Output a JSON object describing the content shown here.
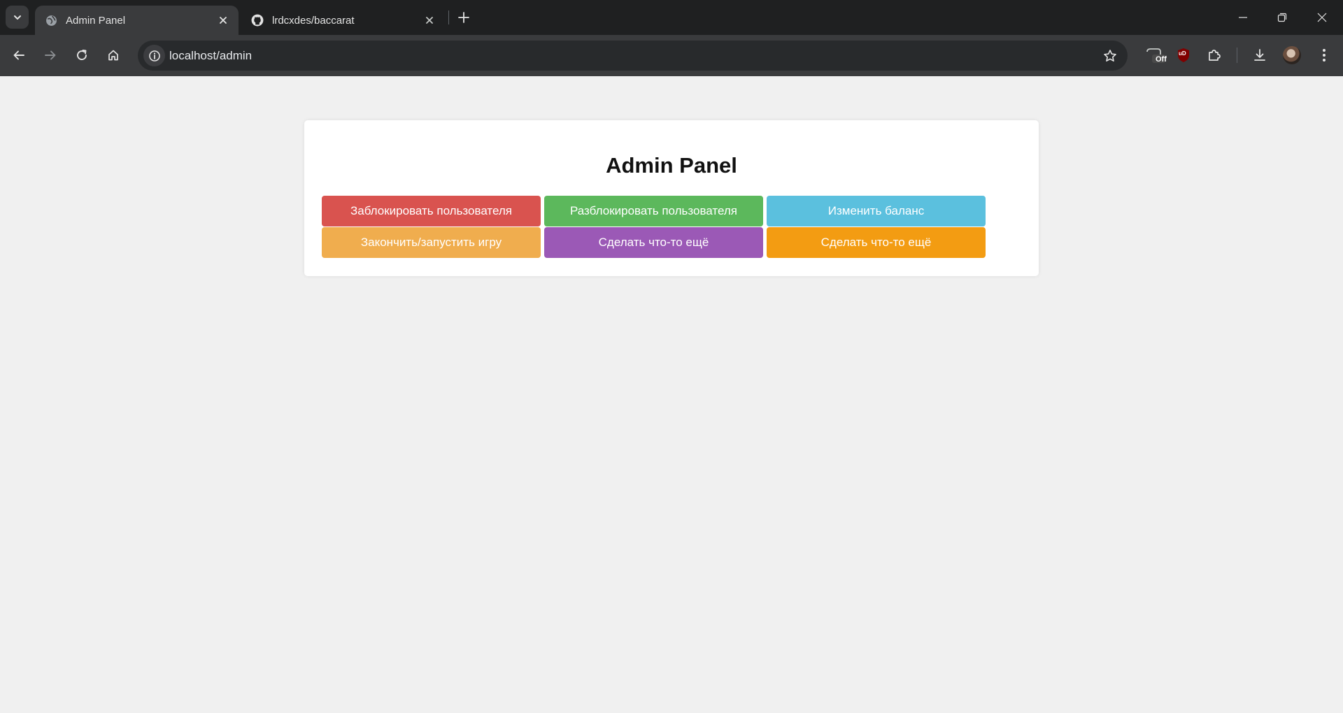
{
  "browser": {
    "tabs": [
      {
        "title": "Admin Panel",
        "favicon": "globe-icon",
        "active": true
      },
      {
        "title": "lrdcxdes/baccarat",
        "favicon": "github-icon",
        "active": false
      }
    ],
    "address_bar": {
      "url": "localhost/admin"
    },
    "extensions": [
      {
        "icon": "off-extension-icon",
        "badge": "Off"
      },
      {
        "icon": "ublock-icon",
        "badge": "uD"
      }
    ]
  },
  "admin": {
    "title": "Admin Panel",
    "buttons": [
      {
        "label": "Заблокировать пользователя",
        "color": "#d9534f"
      },
      {
        "label": "Разблокировать пользователя",
        "color": "#5cb85c"
      },
      {
        "label": "Изменить баланс",
        "color": "#5bc0de"
      },
      {
        "label": "Закончить/запустить игру",
        "color": "#f0ad4e"
      },
      {
        "label": "Сделать что-то ещё",
        "color": "#9b59b6"
      },
      {
        "label": "Сделать что-то ещё",
        "color": "#f39c12"
      }
    ]
  }
}
